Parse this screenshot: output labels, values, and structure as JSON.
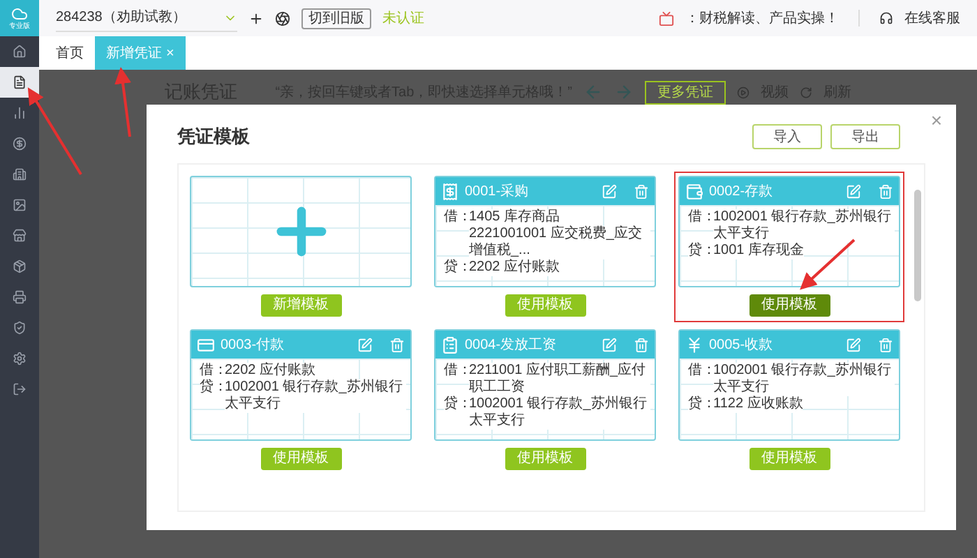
{
  "app": {
    "logo_text": "专业版"
  },
  "sidebar": {
    "items": [
      {
        "kind": "home",
        "selected": false
      },
      {
        "kind": "voucher",
        "selected": true
      },
      {
        "kind": "chart",
        "selected": false
      },
      {
        "kind": "money",
        "selected": false
      },
      {
        "kind": "building",
        "selected": false
      },
      {
        "kind": "image",
        "selected": false
      },
      {
        "kind": "store",
        "selected": false
      },
      {
        "kind": "box",
        "selected": false
      },
      {
        "kind": "printer",
        "selected": false
      },
      {
        "kind": "shield",
        "selected": false
      },
      {
        "kind": "settings",
        "selected": false
      },
      {
        "kind": "export",
        "selected": false
      }
    ]
  },
  "topbar": {
    "account": "284238（劝助试教）",
    "switch_button": "切到旧版",
    "certify_link": "未认证",
    "promo_text": "：财税解读、产品实操！",
    "service": "在线客服"
  },
  "tabs": [
    {
      "label": "首页",
      "selected": false
    },
    {
      "label": "新增凭证",
      "selected": true,
      "close": "×"
    }
  ],
  "background": {
    "title": "记账凭证",
    "hint": "“亲，按回车键或者Tab，即快速选择单元格哦！”",
    "action_button": "更多凭证",
    "video": "视频",
    "refresh": "刷新"
  },
  "modal": {
    "title": "凭证模板",
    "close": "×",
    "buttons": [
      "导入",
      "导出"
    ],
    "new_button": "新增模板",
    "templates": [
      {
        "name": "0001-采购",
        "kind": "purchase",
        "selected": false,
        "button": "使用模板",
        "lines": [
          {
            "side": "借：",
            "text": "1405 库存商品"
          },
          {
            "text": "2221001001 应交税费_应交增值税_..."
          },
          {
            "side": "贷：",
            "text": "2202 应付账款"
          }
        ]
      },
      {
        "name": "0002-存款",
        "kind": "deposit",
        "selected": true,
        "button": "使用模板",
        "lines": [
          {
            "side": "借：",
            "text": "1002001 银行存款_苏州银行太平支行"
          },
          {
            "side": "贷：",
            "text": "1001 库存现金"
          }
        ]
      },
      {
        "name": "0003-付款",
        "kind": "payment",
        "selected": false,
        "button": "使用模板",
        "lines": [
          {
            "side": "借：",
            "text": "2202 应付账款"
          },
          {
            "side": "贷：",
            "text": "1002001 银行存款_苏州银行太平支行"
          }
        ]
      },
      {
        "name": "0004-发放工资",
        "kind": "salary",
        "selected": false,
        "button": "使用模板",
        "lines": [
          {
            "side": "借：",
            "text": "2211001 应付职工薪酬_应付职工工资"
          },
          {
            "side": "贷：",
            "text": "1002001 银行存款_苏州银行太平支行"
          }
        ]
      },
      {
        "name": "0005-收款",
        "kind": "receipt",
        "selected": false,
        "button": "使用模板",
        "lines": [
          {
            "side": "借：",
            "text": "1002001 银行存款_苏州银行太平支行"
          },
          {
            "side": "贷：",
            "text": "1122 应收账款"
          }
        ]
      }
    ]
  }
}
